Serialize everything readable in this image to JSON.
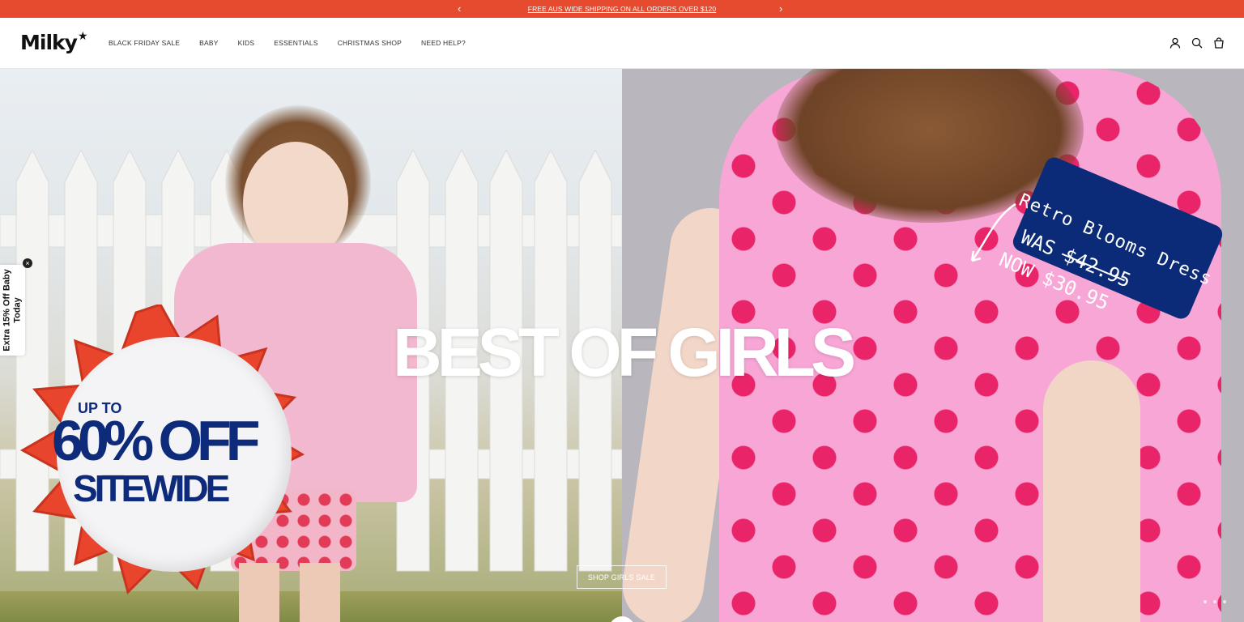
{
  "announcement": {
    "message": "FREE AUS WIDE SHIPPING ON ALL ORDERS OVER $120",
    "prev_icon": "chevron-left-icon",
    "next_icon": "chevron-right-icon",
    "background_color": "#e64b2f"
  },
  "header": {
    "logo_text": "Milky",
    "nav": [
      {
        "label": "BLACK FRIDAY SALE"
      },
      {
        "label": "BABY"
      },
      {
        "label": "KIDS"
      },
      {
        "label": "ESSENTIALS"
      },
      {
        "label": "CHRISTMAS SHOP"
      },
      {
        "label": "NEED HELP?"
      }
    ],
    "icons": [
      "account-icon",
      "search-icon",
      "cart-icon"
    ]
  },
  "hero": {
    "headline": "BEST OF GIRLS",
    "cta_label": "SHOP GIRLS SALE",
    "slides_count": 3,
    "price_tag": {
      "name": "Retro Blooms Dress",
      "was": "WAS $42.95",
      "now": "NOW $30.95",
      "color": "#0b2b78"
    },
    "badge": {
      "line1": "UP TO",
      "line2": "60% OFF",
      "line3": "SITEWIDE",
      "text_color": "#0d2b7a",
      "burst_color": "#e8452c"
    }
  },
  "side_tab": {
    "line1": "Extra 15% Off Baby",
    "line2": "Today",
    "close_label": "×"
  }
}
